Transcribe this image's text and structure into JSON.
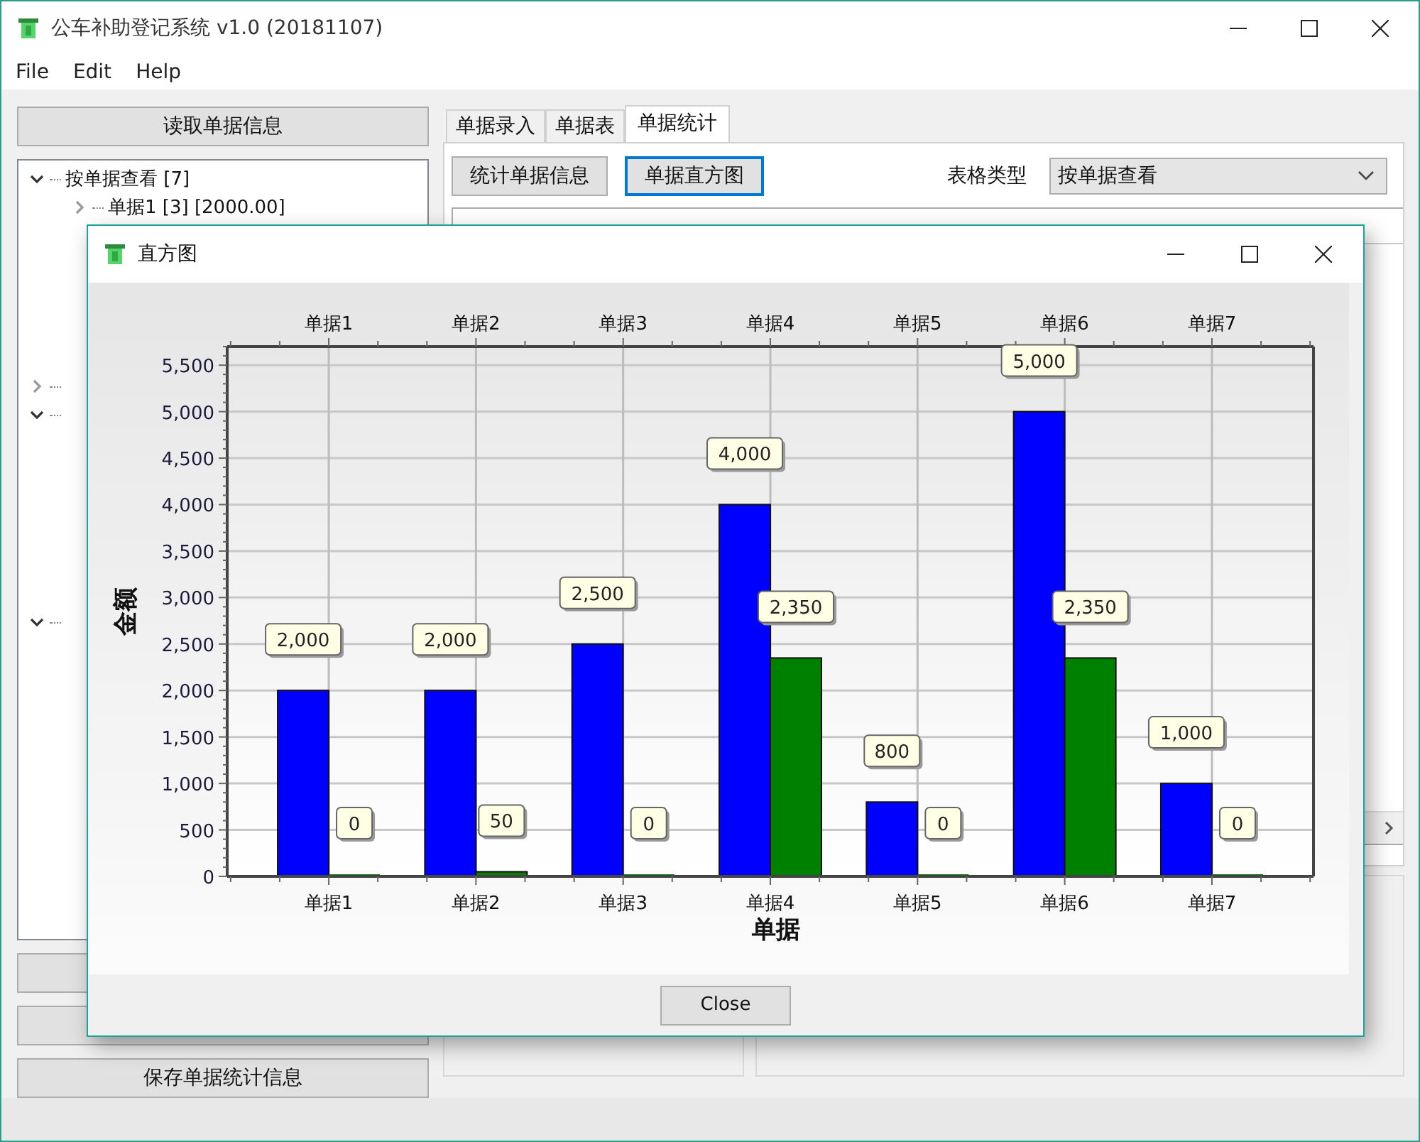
{
  "window": {
    "title": "公车补助登记系统 v1.0 (20181107)"
  },
  "menu": [
    "File",
    "Edit",
    "Help"
  ],
  "left_panel": {
    "top_button": "读取单据信息",
    "tree": [
      {
        "label": "按单据查看 [7]",
        "expanded": true,
        "children": [
          {
            "label": "单据1 [3] [2000.00]",
            "expanded": false
          }
        ]
      },
      {
        "expanded": false
      },
      {
        "expanded": true
      },
      {
        "expanded": true
      }
    ],
    "bottom_buttons": [
      {
        "kind": "covered"
      },
      {
        "kind": "covered"
      },
      {
        "kind": "labeled",
        "label": "保存单据统计信息"
      }
    ]
  },
  "tabs": [
    {
      "label": "单据录入",
      "selected": false
    },
    {
      "label": "单据表",
      "selected": false
    },
    {
      "label": "单据统计",
      "selected": true
    }
  ],
  "toolbar": {
    "buttons": [
      {
        "label": "统计单据信息",
        "focused": false
      },
      {
        "label": "单据直方图",
        "focused": true
      }
    ],
    "table_type_label": "表格类型",
    "table_type_value": "按单据查看"
  },
  "dialog": {
    "title": "直方图",
    "close_button": "Close",
    "chart_data": {
      "type": "bar",
      "xlabel": "单据",
      "ylabel": "金额",
      "categories": [
        "单据1",
        "单据2",
        "单据3",
        "单据4",
        "单据5",
        "单据6",
        "单据7"
      ],
      "annotations": [
        "单据1",
        "单据2",
        "单据3",
        "单据4",
        "单据5",
        "单据6",
        "单据7"
      ],
      "grid": true,
      "series": [
        {
          "color": "#0000ff",
          "values": [
            2000,
            2000,
            2500,
            4000,
            800,
            5000,
            1000
          ]
        },
        {
          "color": "#008000",
          "values": [
            0,
            50,
            0,
            2350,
            0,
            2350,
            0
          ]
        }
      ],
      "ylim": [
        0,
        5700
      ],
      "yticks": [
        {
          "value": 0,
          "label": "0"
        },
        {
          "value": 500,
          "label": "500"
        },
        {
          "value": 1000,
          "label": "1,000"
        },
        {
          "value": 1500,
          "label": "1,500"
        },
        {
          "value": 2000,
          "label": "2,000"
        },
        {
          "value": 2500,
          "label": "2,500"
        },
        {
          "value": 3000,
          "label": "3,000"
        },
        {
          "value": 3500,
          "label": "3,500"
        },
        {
          "value": 4000,
          "label": "4,000"
        },
        {
          "value": 4500,
          "label": "4,500"
        },
        {
          "value": 5000,
          "label": "5,000"
        },
        {
          "value": 5500,
          "label": "5,500"
        }
      ],
      "value_labels": [
        [
          "2,000",
          "2,000",
          "2,500",
          "4,000",
          "800",
          "5,000",
          "1,000"
        ],
        [
          "0",
          "50",
          "0",
          "2,350",
          "0",
          "2,350",
          "0"
        ]
      ]
    }
  }
}
